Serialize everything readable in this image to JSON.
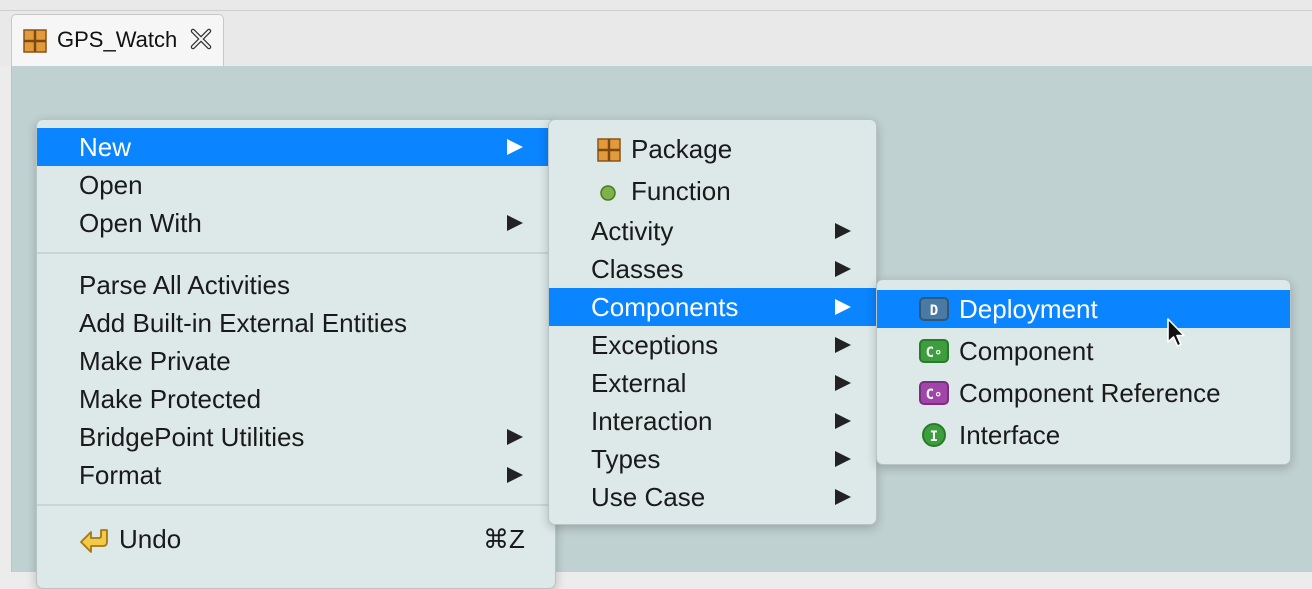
{
  "editor": {
    "tab_title": "GPS_Watch",
    "tab_icon": "package-icon",
    "close_icon": "close-tab-icon"
  },
  "context_menu": {
    "items": [
      {
        "label": "New",
        "submenu": true,
        "selected": true
      },
      {
        "label": "Open"
      },
      {
        "label": "Open With",
        "submenu": true
      },
      {
        "label": "Parse All Activities"
      },
      {
        "label": "Add Built-in External Entities"
      },
      {
        "label": "Make Private"
      },
      {
        "label": "Make Protected"
      },
      {
        "label": "BridgePoint Utilities",
        "submenu": true
      },
      {
        "label": "Format",
        "submenu": true
      },
      {
        "label": "Undo",
        "shortcut": "⌘Z",
        "icon": "undo-icon"
      }
    ]
  },
  "new_submenu": {
    "items": [
      {
        "label": "Package",
        "icon": "package-icon"
      },
      {
        "label": "Function",
        "icon": "function-icon"
      },
      {
        "label": "Activity",
        "submenu": true
      },
      {
        "label": "Classes",
        "submenu": true
      },
      {
        "label": "Components",
        "submenu": true,
        "selected": true
      },
      {
        "label": "Exceptions",
        "submenu": true
      },
      {
        "label": "External",
        "submenu": true
      },
      {
        "label": "Interaction",
        "submenu": true
      },
      {
        "label": "Types",
        "submenu": true
      },
      {
        "label": "Use Case",
        "submenu": true
      }
    ]
  },
  "components_submenu": {
    "items": [
      {
        "label": "Deployment",
        "icon": "deployment-icon",
        "badge": "D",
        "selected": true
      },
      {
        "label": "Component",
        "icon": "component-icon",
        "badge": "C∘"
      },
      {
        "label": "Component Reference",
        "icon": "component-reference-icon",
        "badge": "C∘"
      },
      {
        "label": "Interface",
        "icon": "interface-icon",
        "badge": "I"
      }
    ]
  },
  "colors": {
    "selection": "#0a84ff",
    "canvas": "#c0d1d1",
    "menu_bg": "#dde9e9"
  }
}
